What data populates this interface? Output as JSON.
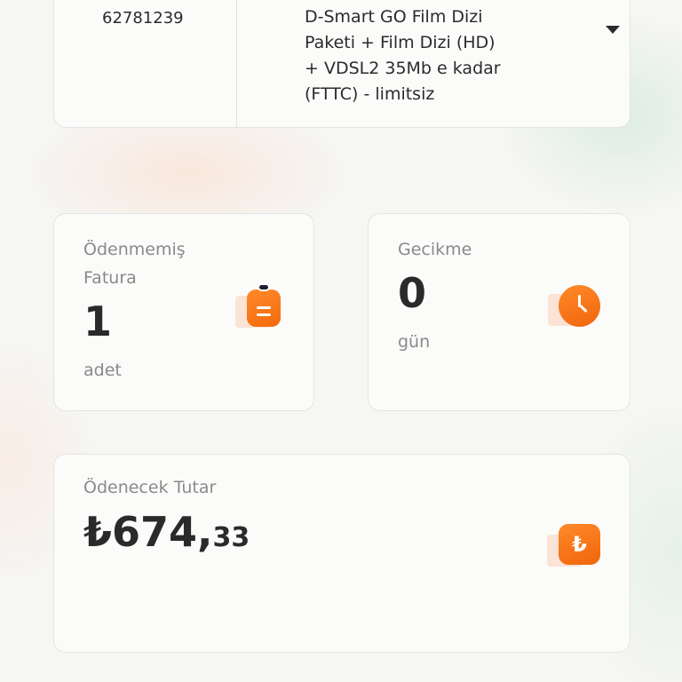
{
  "package_card": {
    "subscriber_number": "62781239",
    "package_name": "D-Smart GO Film Dizi Paketi + Film Dizi (HD) + VDSL2 35Mb e kadar (FTTC) - limitsiz",
    "dropdown_icon": "caret-down-icon"
  },
  "unpaid_invoice": {
    "label": "Ödenmemiş Fatura",
    "value": "1",
    "unit": "adet",
    "icon": "clipboard-icon"
  },
  "delay": {
    "label": "Gecikme",
    "value": "0",
    "unit": "gün",
    "icon": "clock-icon"
  },
  "amount_due": {
    "label": "Ödenecek Tutar",
    "currency_symbol": "₺",
    "whole": "674,",
    "cents": "33",
    "icon": "lira-icon",
    "icon_glyph": "₺"
  },
  "colors": {
    "accent": "#f26a0b",
    "text_primary": "#2a2a2a",
    "text_secondary": "#8a8a8a",
    "card_bg": "#fbfbfa"
  }
}
